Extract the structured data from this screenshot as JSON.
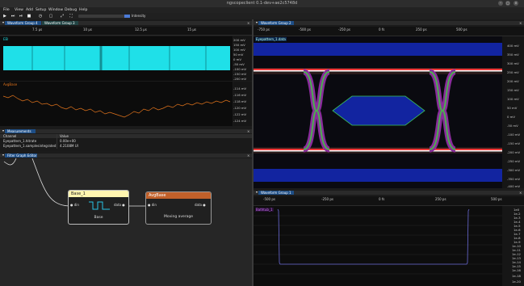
{
  "window": {
    "title": "ngscopeclient 0.1-dev+ae2c5748d"
  },
  "menu": [
    "File",
    "View",
    "Add",
    "Setup",
    "Window",
    "Debug",
    "Help"
  ],
  "toolbar": {
    "intensity_label": "Intensity",
    "intensity_checked": true
  },
  "waveform_group_4": {
    "tabs": [
      "Waveform Group 4",
      "Waveform Group 3"
    ],
    "time_ticks": [
      "7.5 µs",
      "10 µs",
      "12.5 µs",
      "15 µs"
    ],
    "top_channel_label": "EB",
    "top_channel_color": "#1fe0e8",
    "top_axis": [
      "200 mV",
      "150 mV",
      "100 mV",
      "50 mV",
      "0 mV",
      "-50 mV",
      "-100 mV",
      "-150 mV",
      "-200 mV"
    ],
    "bottom_channel_label": "AvgBase",
    "bottom_channel_color": "#e0731c",
    "bottom_axis": [
      "-114 mV",
      "-116 mV",
      "-118 mV",
      "-120 mV",
      "-122 mV",
      "-124 mV"
    ]
  },
  "measurements": {
    "tab": "Measurements",
    "columns": [
      "Channel",
      "Value"
    ],
    "rows": [
      [
        "Eyepattern_1.hitrate",
        "0.00e+00"
      ],
      [
        "Eyepattern_1.samplesintegrated",
        "4.2108M UI"
      ]
    ]
  },
  "filter_graph": {
    "tab": "Filter Graph Editor",
    "base_node": {
      "title": "Base_1",
      "input": "din",
      "output": "data",
      "caption": "Base"
    },
    "avg_node": {
      "title": "AvgBase",
      "input": "din",
      "output": "data",
      "caption": "Moving average"
    }
  },
  "waveform_group_2": {
    "tab": "Waveform Group 2",
    "time_ticks": [
      "-750 ps",
      "-500 ps",
      "-250 ps",
      "0 fs",
      "250 ps",
      "500 ps"
    ],
    "channel_label": "Eyepattern_1.data",
    "axis": [
      "400 mV",
      "350 mV",
      "300 mV",
      "250 mV",
      "200 mV",
      "150 mV",
      "100 mV",
      "50 mV",
      "0 mV",
      "-50 mV",
      "-100 mV",
      "-150 mV",
      "-200 mV",
      "-250 mV",
      "-300 mV",
      "-350 mV",
      "-400 mV"
    ]
  },
  "waveform_group_1": {
    "tab": "Waveform Group 1",
    "time_ticks": [
      "-500 ps",
      "-250 ps",
      "0 fs",
      "250 ps",
      "500 ps"
    ],
    "channel_label": "Bathtub_1",
    "axis": [
      "1e0",
      "1e-2",
      "1e-3",
      "1e-4",
      "1e-5",
      "1e-6",
      "1e-7",
      "1e-8",
      "1e-9",
      "1e-10",
      "1e-11",
      "1e-12",
      "1e-13",
      "1e-14",
      "1e-15",
      "1e-16",
      "1e-18",
      "1e-20"
    ]
  },
  "colors": {
    "tab_active": "#1e4e86",
    "eye_mask": "#1224a0",
    "node_base": "#fff5b0",
    "node_avg": "#c0602a"
  }
}
